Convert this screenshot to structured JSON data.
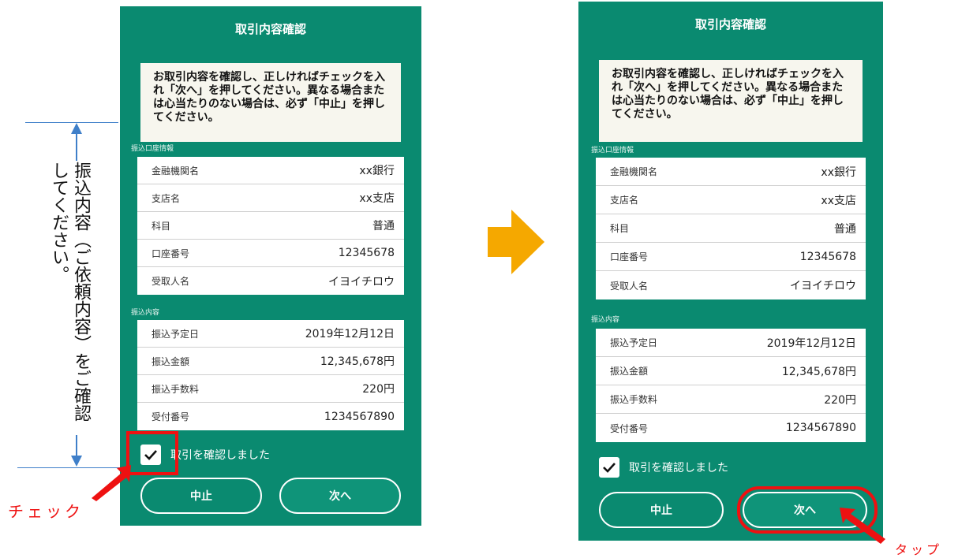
{
  "screens": [
    {
      "title": "取引内容確認",
      "notice": "お取引内容を確認し、正しければチェックを入れ「次へ」を押してください。異なる場合または心当たりのない場合は、必ず「中止」を押してください。",
      "account_section_label": "振込口座情報",
      "account_rows": [
        {
          "label": "金融機関名",
          "value": "xx銀行"
        },
        {
          "label": "支店名",
          "value": "xx支店"
        },
        {
          "label": "科目",
          "value": "普通"
        },
        {
          "label": "口座番号",
          "value": "12345678"
        },
        {
          "label": "受取人名",
          "value": "イヨイチロウ"
        }
      ],
      "transfer_section_label": "振込内容",
      "transfer_rows": [
        {
          "label": "振込予定日",
          "value": "2019年12月12日"
        },
        {
          "label": "振込金額",
          "value": "12,345,678円"
        },
        {
          "label": "振込手数料",
          "value": "220円"
        },
        {
          "label": "受付番号",
          "value": "1234567890"
        }
      ],
      "confirm_checkbox_label": "取引を確認しました",
      "confirm_checked": true,
      "cancel_button": "中止",
      "next_button": "次へ"
    },
    {
      "title": "取引内容確認",
      "notice": "お取引内容を確認し、正しければチェックを入れ「次へ」を押してください。異なる場合または心当たりのない場合は、必ず「中止」を押してください。",
      "account_section_label": "振込口座情報",
      "account_rows": [
        {
          "label": "金融機関名",
          "value": "xx銀行"
        },
        {
          "label": "支店名",
          "value": "xx支店"
        },
        {
          "label": "科目",
          "value": "普通"
        },
        {
          "label": "口座番号",
          "value": "12345678"
        },
        {
          "label": "受取人名",
          "value": "イヨイチロウ"
        }
      ],
      "transfer_section_label": "振込内容",
      "transfer_rows": [
        {
          "label": "振込予定日",
          "value": "2019年12月12日"
        },
        {
          "label": "振込金額",
          "value": "12,345,678円"
        },
        {
          "label": "振込手数料",
          "value": "220円"
        },
        {
          "label": "受付番号",
          "value": "1234567890"
        }
      ],
      "confirm_checkbox_label": "取引を確認しました",
      "confirm_checked": true,
      "cancel_button": "中止",
      "next_button": "次へ"
    }
  ],
  "annotations": {
    "left_note": "振込内容（ご依頼内容）をご確認してください。",
    "check_label": "チェック",
    "tap_label": "タップ"
  },
  "colors": {
    "screen_background": "#0a8a70",
    "annotation_red": "#ee1111",
    "arrow_orange": "#f5a800",
    "guide_blue": "#3f7fc9"
  },
  "icons": [
    "checkmark-icon",
    "right-arrow-icon",
    "pointer-arrow-icon",
    "up-arrow-icon",
    "down-arrow-icon"
  ]
}
